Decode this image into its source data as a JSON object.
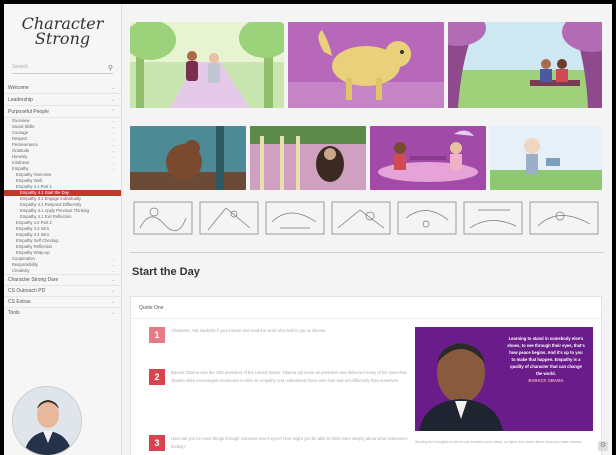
{
  "app": {
    "logo_text": "Character\nStrong"
  },
  "sidebar": {
    "search_placeholder": "Search",
    "top_items": [
      {
        "label": "Welcome"
      },
      {
        "label": "Leadership"
      },
      {
        "label": "Purposeful People"
      }
    ],
    "sub_items": [
      {
        "label": "Overview",
        "depth": 1
      },
      {
        "label": "Social Skills",
        "depth": 1
      },
      {
        "label": "Courage",
        "depth": 1
      },
      {
        "label": "Respect",
        "depth": 1
      },
      {
        "label": "Perseverance",
        "depth": 1
      },
      {
        "label": "Gratitude",
        "depth": 1
      },
      {
        "label": "Honesty",
        "depth": 1
      },
      {
        "label": "Kindness",
        "depth": 1
      },
      {
        "label": "Empathy",
        "depth": 1
      },
      {
        "label": "Empathy Overview",
        "depth": 2
      },
      {
        "label": "Empathy Wall",
        "depth": 2
      },
      {
        "label": "Empathy 4.1 Part 1",
        "depth": 2
      },
      {
        "label": "Empathy 4.1 Start the Day",
        "depth": 3,
        "active": true
      },
      {
        "label": "Empathy 4.1 Engage Individually",
        "depth": 3
      },
      {
        "label": "Empathy 4.1 Respond Differently",
        "depth": 3
      },
      {
        "label": "Empathy 4.1 Apply Previous Thinking",
        "depth": 3
      },
      {
        "label": "Empathy 4.1 Exit Reflection",
        "depth": 3
      },
      {
        "label": "Empathy 4.2 Part 2",
        "depth": 2
      },
      {
        "label": "Empathy 4.3 Intro",
        "depth": 2
      },
      {
        "label": "Empathy 4.4 Intro",
        "depth": 2
      },
      {
        "label": "Empathy Self Checkup",
        "depth": 2
      },
      {
        "label": "Empathy Reflection",
        "depth": 2
      },
      {
        "label": "Empathy Wrap-up",
        "depth": 2
      },
      {
        "label": "Cooperation",
        "depth": 1
      },
      {
        "label": "Responsibility",
        "depth": 1
      },
      {
        "label": "Creativity",
        "depth": 1
      }
    ],
    "bottom_items": [
      {
        "label": "Character Strong Dare"
      },
      {
        "label": "CS Outreach PD"
      },
      {
        "label": "CS Extras"
      },
      {
        "label": "Tools"
      }
    ]
  },
  "main": {
    "section_title": "Start the Day",
    "card_title": "Quote One",
    "steps": [
      {
        "num": "1",
        "text": "Character: Ask students if you'd share and read the word who said to you & choose."
      },
      {
        "num": "2",
        "text": "Barack Obama was the 44th president of the United States. Obama did serve as president and delivered many of his speeches. Obama often encouraged Americans to take on empathy and understand those who look and act differently than ourselves."
      },
      {
        "num": "3",
        "text": "How can you be more things through someone else's eyes? How might you be able to think more deeply about what someone's feeling?"
      }
    ],
    "quote": {
      "text": "Learning to stand in somebody else's shoes, to see through their eyes, that's how peace begins. And it's up to you to make that happen. Empathy is a quality of character that can change the world.",
      "author": "BARACK OBAMA",
      "caption": "Sharing the thoughts of others can broaden your views, so listen and share about what you have learned."
    }
  },
  "colors": {
    "accent": "#d84350",
    "quote_bg": "#6a1c8a",
    "active_nav": "#c0392b"
  }
}
